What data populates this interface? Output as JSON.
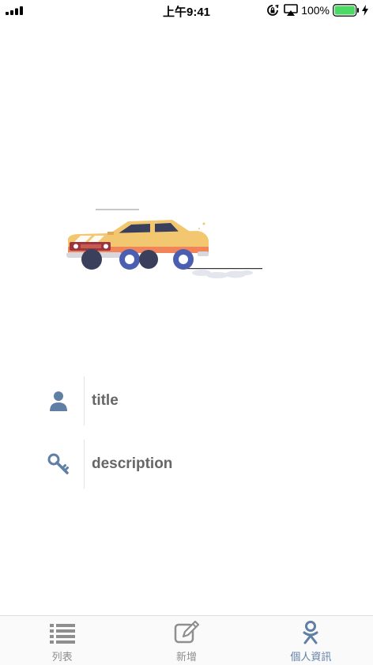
{
  "status_bar": {
    "time": "上午9:41",
    "battery_percent": "100%"
  },
  "colors": {
    "accent": "#5f7fa4",
    "tab_inactive": "#8e8e8e",
    "battery": "#4cd964",
    "car_body": "#f2c76f",
    "car_stripe": "#f2845a"
  },
  "form": {
    "title_placeholder": "title",
    "description_placeholder": "description",
    "title_icon": "user-icon",
    "description_icon": "key-icon"
  },
  "tabs": [
    {
      "label": "列表",
      "icon": "list-icon",
      "active": false
    },
    {
      "label": "新增",
      "icon": "edit-icon",
      "active": false
    },
    {
      "label": "個人資訊",
      "icon": "odnoklassniki-icon",
      "active": true
    }
  ]
}
